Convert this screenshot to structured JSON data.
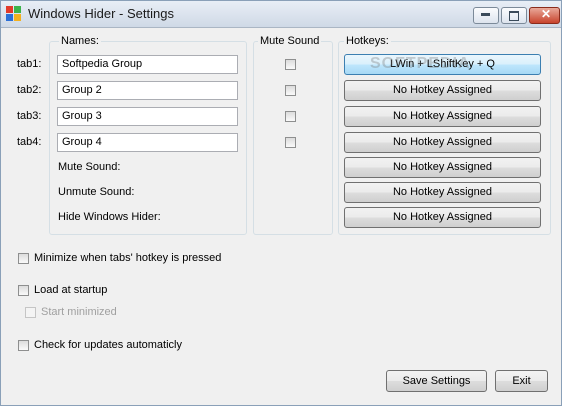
{
  "window": {
    "title": "Windows Hider - Settings",
    "controls": {
      "minimize": "–",
      "maximize": "□",
      "close": "✕"
    }
  },
  "names_group": {
    "label": "Names:",
    "rows": [
      {
        "tab_label": "tab1:",
        "value": "Softpedia Group"
      },
      {
        "tab_label": "tab2:",
        "value": "Group 2"
      },
      {
        "tab_label": "tab3:",
        "value": "Group 3"
      },
      {
        "tab_label": "tab4:",
        "value": "Group 4"
      }
    ],
    "extra_labels": [
      "Mute Sound:",
      "Unmute Sound:",
      "Hide Windows Hider:"
    ]
  },
  "mute_group": {
    "label": "Mute Sound",
    "checked": [
      false,
      false,
      false,
      false
    ]
  },
  "hotkeys_group": {
    "label": "Hotkeys:",
    "buttons": [
      "LWin + LShiftKey + Q",
      "No Hotkey Assigned",
      "No Hotkey Assigned",
      "No Hotkey Assigned",
      "No Hotkey Assigned",
      "No Hotkey Assigned",
      "No Hotkey Assigned"
    ]
  },
  "options": {
    "minimize_on_hotkey": {
      "label": "Minimize when tabs' hotkey is pressed",
      "checked": false
    },
    "load_at_startup": {
      "label": "Load at startup",
      "checked": false
    },
    "start_minimized": {
      "label": "Start minimized",
      "checked": false,
      "disabled": true
    },
    "check_updates": {
      "label": "Check for updates automaticly",
      "checked": false
    }
  },
  "footer": {
    "save_label": "Save Settings",
    "exit_label": "Exit"
  },
  "watermark": "SOFTPEDIA"
}
